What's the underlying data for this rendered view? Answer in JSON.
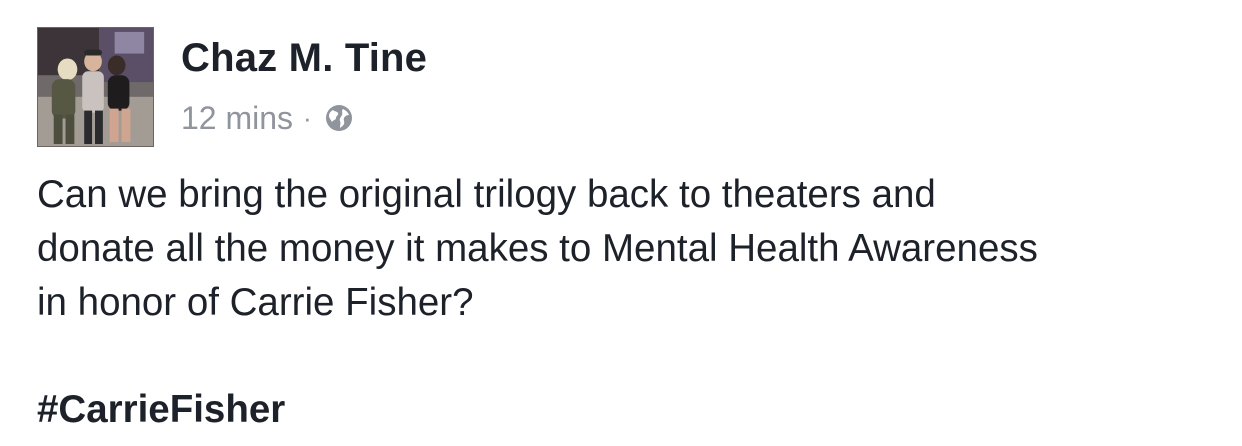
{
  "post": {
    "author": {
      "name": "Chaz M. Tine",
      "avatar_icon": "profile-photo"
    },
    "meta": {
      "timestamp": "12 mins",
      "separator": "·",
      "privacy_icon": "globe-icon"
    },
    "body": {
      "lines": [
        "Can we bring the original trilogy back to theaters and",
        "donate all the money it makes to Mental Health Awareness",
        "in honor of Carrie Fisher?"
      ]
    },
    "hashtag": "#CarrieFisher"
  },
  "colors": {
    "text_primary": "#1d2129",
    "text_secondary": "#90949c",
    "background": "#ffffff"
  }
}
